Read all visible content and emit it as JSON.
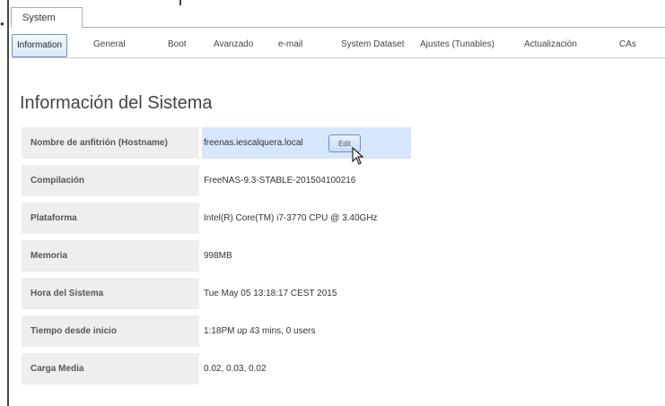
{
  "window": {
    "outer_tab": "System"
  },
  "tabs": [
    {
      "label": "Information",
      "active": true
    },
    {
      "label": "General"
    },
    {
      "label": "Boot"
    },
    {
      "label": "Avanzado"
    },
    {
      "label": "e-mail"
    },
    {
      "label": "System Dataset"
    },
    {
      "label": "Ajustes (Tunables)"
    },
    {
      "label": "Actualización"
    },
    {
      "label": "CAs"
    }
  ],
  "page": {
    "title": "Información del Sistema"
  },
  "info_rows": [
    {
      "label": "Nombre de anfitrión (Hostname)",
      "value": "freenas.iescalquera.local",
      "edit_label": "Edit"
    },
    {
      "label": "Compilación",
      "value": "FreeNAS-9.3-STABLE-201504100216"
    },
    {
      "label": "Plataforma",
      "value": "Intel(R) Core(TM) i7-3770 CPU @ 3.40GHz"
    },
    {
      "label": "Memoria",
      "value": "998MB"
    },
    {
      "label": "Hora del Sistema",
      "value": "Tue May 05 13:18:17 CEST 2015"
    },
    {
      "label": "Tiempo desde inicio",
      "value": "1:18PM up 43 mins, 0 users"
    },
    {
      "label": "Carga Media",
      "value": "0.02, 0.03, 0.02"
    }
  ],
  "colors": {
    "highlight": "#d6e6fb",
    "active_tab_border": "#6b8fc7"
  },
  "icons": {
    "cursor": "mouse-pointer-icon"
  }
}
